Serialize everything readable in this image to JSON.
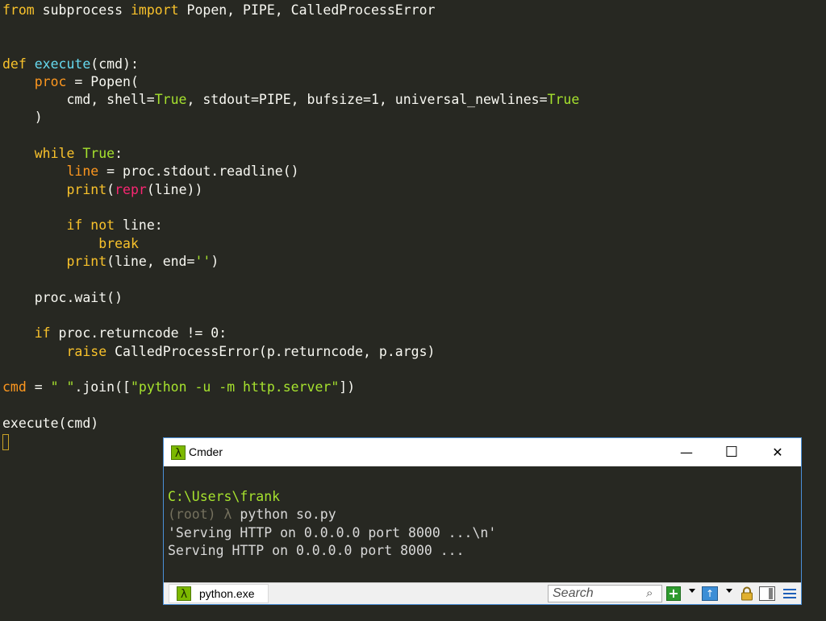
{
  "editor": {
    "line1": {
      "kw1": "from",
      "t1": " subprocess ",
      "kw2": "import",
      "t2": " Popen, PIPE, CalledProcessError"
    },
    "line2": {
      "kw": "def",
      "t1": " ",
      "fn": "execute",
      "t2": "(cmd):"
    },
    "line3": {
      "indent": "    ",
      "var": "proc",
      "t": " = Popen("
    },
    "line4": {
      "t1": "        cmd, shell=",
      "b1": "True",
      "t2": ", stdout=PIPE, bufsize=1, universal_newlines=",
      "b2": "True"
    },
    "line5": {
      "t": "    )"
    },
    "line6": {
      "indent": "    ",
      "kw": "while",
      "t": " ",
      "b": "True",
      "t2": ":"
    },
    "line7": {
      "indent": "        ",
      "var": "line",
      "t": " = proc.stdout.readline()"
    },
    "line8": {
      "indent": "        ",
      "builtin": "print",
      "t1": "(",
      "repr": "repr",
      "t2": "(line))"
    },
    "line9": {
      "indent": "        ",
      "kw": "if not",
      "t": " line:"
    },
    "line10": {
      "indent": "            ",
      "kw": "break"
    },
    "line11": {
      "indent": "        ",
      "builtin": "print",
      "t1": "(line, end=",
      "s": "''",
      "t2": ")"
    },
    "line12": {
      "t": "    proc.wait()"
    },
    "line13": {
      "indent": "    ",
      "kw": "if",
      "t": " proc.returncode != 0:"
    },
    "line14": {
      "indent": "        ",
      "kw": "raise",
      "t": " CalledProcessError(p.returncode, p.args)"
    },
    "line15": {
      "var": "cmd",
      "t1": " = ",
      "s1": "\" \"",
      "t2": ".join([",
      "s2": "\"python -u -m http.server\"",
      "t3": "])"
    },
    "line16": {
      "t": "execute(cmd)"
    }
  },
  "cmder": {
    "title": "Cmder",
    "icon": "lambda-icon",
    "lambda": "λ",
    "minimize": "—",
    "maximize": "☐",
    "close": "✕",
    "terminal": {
      "path": "C:\\Users\\frank",
      "prompt_env": "(root) λ",
      "command": " python so.py",
      "out1": "'Serving HTTP on 0.0.0.0 port 8000 ...\\n'",
      "out2": "Serving HTTP on 0.0.0.0 port 8000 ..."
    },
    "status": {
      "tab_label": "python.exe",
      "search_placeholder": "Search",
      "search_icon": "⌕",
      "plus": "+",
      "up": "↑"
    },
    "colors": {
      "accent": "#4a90d9",
      "lambda_green": "#7cb800"
    }
  }
}
